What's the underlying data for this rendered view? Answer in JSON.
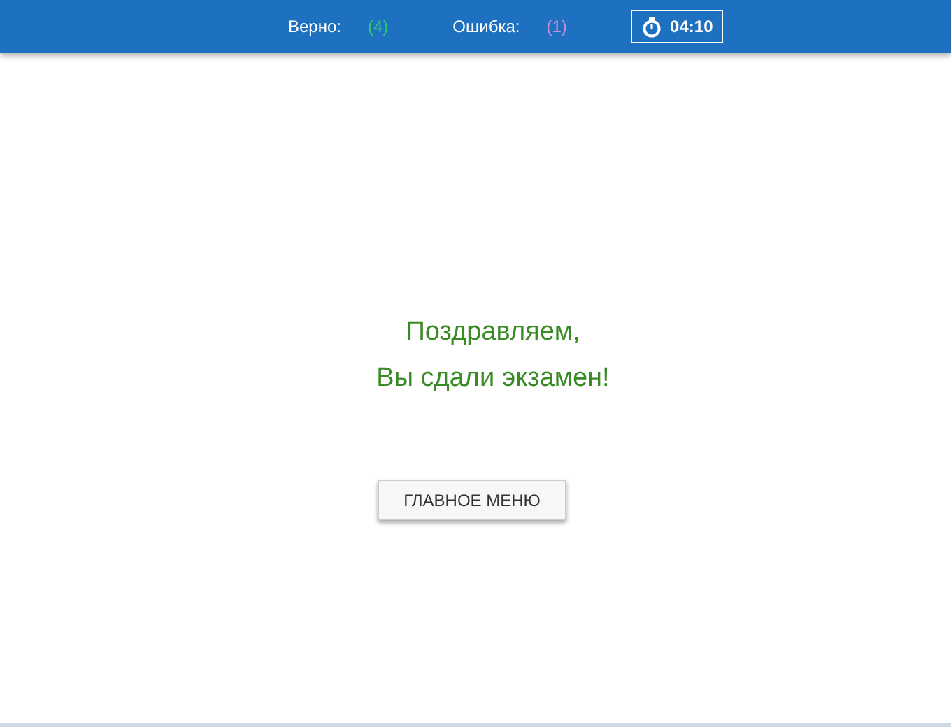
{
  "header": {
    "stats": [
      {
        "label": "Верно:",
        "count": "(4)",
        "color": "#2ecc71"
      },
      {
        "label": "Ошибка:",
        "count": "(1)",
        "color": "#c58fd6"
      }
    ],
    "timer": "04:10"
  },
  "message": [
    "Поздравляем,",
    "Вы сдали экзамен!"
  ],
  "button": "ГЛАВНОЕ МЕНЮ"
}
